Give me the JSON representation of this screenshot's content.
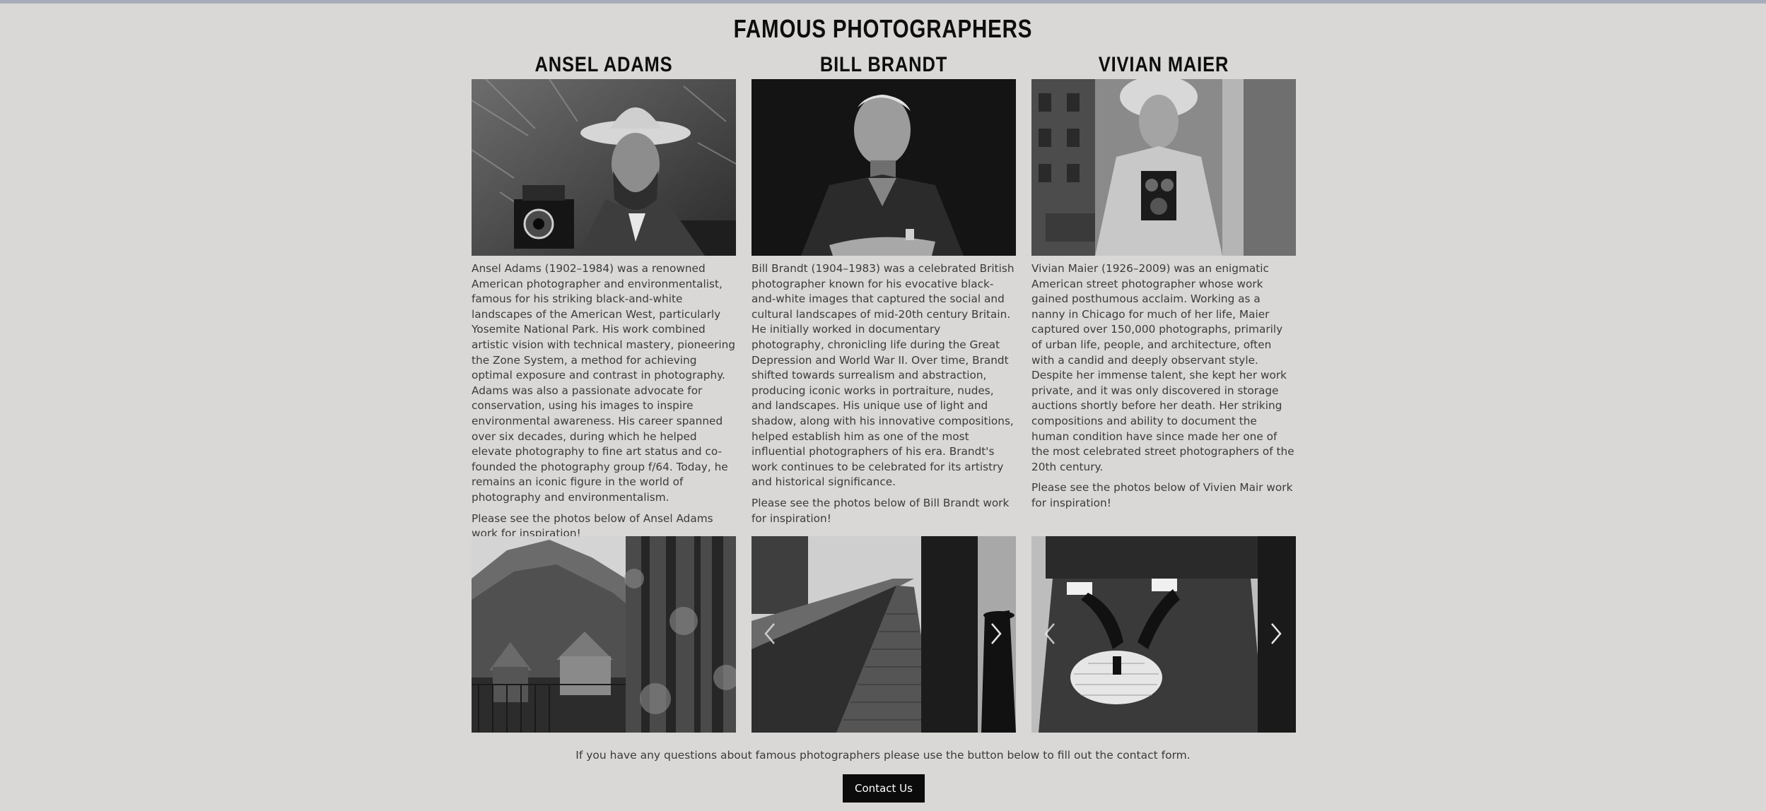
{
  "page": {
    "title": "FAMOUS PHOTOGRAPHERS"
  },
  "photographers": [
    {
      "name": "ANSEL ADAMS",
      "description": "Ansel Adams (1902–1984) was a renowned American photographer and environmentalist, famous for his striking black-and-white landscapes of the American West, particularly Yosemite National Park. His work combined artistic vision with technical mastery, pioneering the Zone System, a method for achieving optimal exposure and contrast in photography. Adams was also a passionate advocate for conservation, using his images to inspire environmental awareness. His career spanned over six decades, during which he helped elevate photography to fine art status and co-founded the photography group f/64. Today, he remains an iconic figure in the world of photography and environmentalism.",
      "note": "Please see the photos below of Ansel Adams work for inspiration!"
    },
    {
      "name": "BILL BRANDT",
      "description": "Bill Brandt (1904–1983) was a celebrated British photographer known for his evocative black-and-white images that captured the social and cultural landscapes of mid-20th century Britain. He initially worked in documentary photography, chronicling life during the Great Depression and World War II. Over time, Brandt shifted towards surrealism and abstraction, producing iconic works in portraiture, nudes, and landscapes. His unique use of light and shadow, along with his innovative compositions, helped establish him as one of the most influential photographers of his era. Brandt's work continues to be celebrated for its artistry and historical significance.",
      "note": "Please see the photos below of Bill Brandt work for inspiration!"
    },
    {
      "name": "VIVIAN MAIER",
      "description": "Vivian Maier (1926–2009) was an enigmatic American street photographer whose work gained posthumous acclaim. Working as a nanny in Chicago for much of her life, Maier captured over 150,000 photographs, primarily of urban life, people, and architecture, often with a candid and deeply observant style. Despite her immense talent, she kept her work private, and it was only discovered in storage auctions shortly before her death. Her striking compositions and ability to document the human condition have since made her one of the most celebrated street photographers of the 20th century.",
      "note": "Please see the photos below of Vivien Mair work for inspiration!"
    }
  ],
  "footer": {
    "text": "If you have any questions about famous photographers please use the button below to fill out the contact form.",
    "button_label": "Contact Us"
  },
  "icons": {
    "prev": "chevron-left-icon",
    "next": "chevron-right-icon"
  },
  "colors": {
    "background": "#d9d8d6",
    "top_bar": "#a7acba",
    "button": "#0b0b0b"
  }
}
